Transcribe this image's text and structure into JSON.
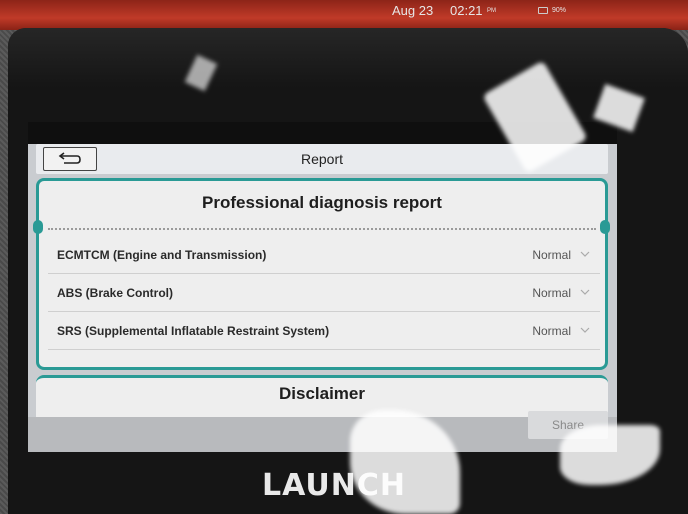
{
  "status_bar": {
    "date": "Aug 23",
    "time": "02:21",
    "ampm": "PM",
    "battery": "90%"
  },
  "header": {
    "title": "Report"
  },
  "report": {
    "heading": "Professional diagnosis report",
    "rows": [
      {
        "label": "ECMTCM (Engine and Transmission)",
        "status": "Normal"
      },
      {
        "label": "ABS (Brake Control)",
        "status": "Normal"
      },
      {
        "label": "SRS (Supplemental Inflatable Restraint System)",
        "status": "Normal"
      }
    ]
  },
  "disclaimer": {
    "heading": "Disclaimer"
  },
  "actions": {
    "share_label": "Share"
  },
  "device": {
    "brand": "LAUNCH"
  },
  "colors": {
    "accent": "#2a9a95",
    "brand_rim": "#c03a28"
  }
}
